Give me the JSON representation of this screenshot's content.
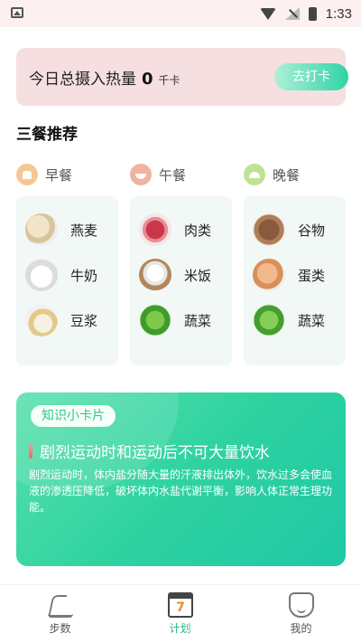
{
  "status_bar": {
    "time": "1:33",
    "icons": [
      "photo-icon",
      "wifi-icon",
      "signal-icon",
      "battery-icon"
    ]
  },
  "intake": {
    "label": "今日总摄入热量",
    "value": "0",
    "unit": "千卡",
    "button": "去打卡"
  },
  "section_title": "三餐推荐",
  "meals": [
    {
      "name": "早餐",
      "icon": "bread-icon",
      "color": "#f4c892",
      "foods": [
        {
          "name": "燕麦",
          "image": "oats"
        },
        {
          "name": "牛奶",
          "image": "milk"
        },
        {
          "name": "豆浆",
          "image": "soymilk"
        }
      ]
    },
    {
      "name": "午餐",
      "icon": "bowl-icon",
      "color": "#f0b39f",
      "foods": [
        {
          "name": "肉类",
          "image": "meat"
        },
        {
          "name": "米饭",
          "image": "rice"
        },
        {
          "name": "蔬菜",
          "image": "vegetables"
        }
      ]
    },
    {
      "name": "晚餐",
      "icon": "cloche-icon",
      "color": "#bfe394",
      "foods": [
        {
          "name": "谷物",
          "image": "grain"
        },
        {
          "name": "蛋类",
          "image": "egg"
        },
        {
          "name": "蔬菜",
          "image": "vegetables"
        }
      ]
    }
  ],
  "knowledge": {
    "tag": "知识小卡片",
    "title": "剧烈运动时和运动后不可大量饮水",
    "body": "剧烈运动时，体内盐分随大量的汗液排出体外，饮水过多会使血液的渗透压降低，破坏体内水盐代谢平衡，影响人体正常生理功能。"
  },
  "nav": [
    {
      "label": "步数",
      "icon": "shoe-icon",
      "active": false
    },
    {
      "label": "计划",
      "icon": "calendar-icon",
      "active": true,
      "icon_text": "7"
    },
    {
      "label": "我的",
      "icon": "profile-icon",
      "active": false
    }
  ],
  "colors": {
    "accent": "#2bb98b",
    "intake_card_bg": "#f6dfe0",
    "meal_box_bg": "#f1f8f6",
    "knowledge_gradient_start": "#58e0ad",
    "knowledge_gradient_end": "#1fc7a6"
  }
}
